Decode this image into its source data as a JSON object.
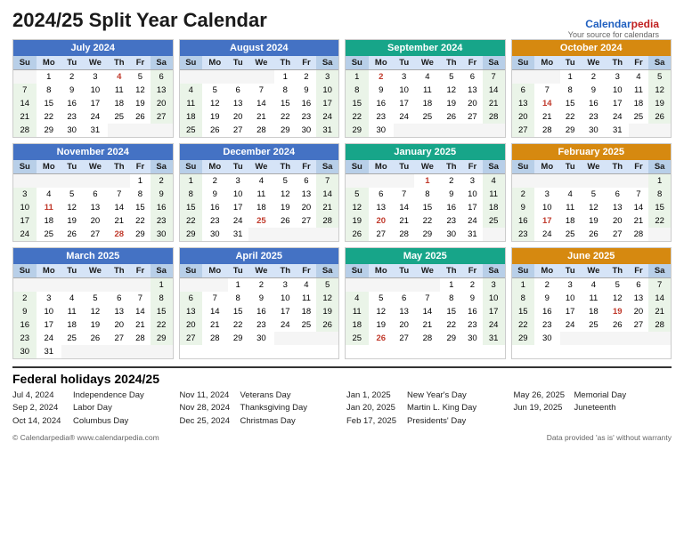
{
  "title": "2024/25 Split Year Calendar",
  "brand": {
    "name1": "Calendar",
    "name2": "pedia",
    "tagline": "Your source for calendars"
  },
  "months": [
    {
      "name": "July 2024",
      "color": "blue",
      "days": [
        [
          null,
          1,
          2,
          3,
          "4h",
          5,
          6
        ],
        [
          7,
          8,
          9,
          10,
          11,
          12,
          13
        ],
        [
          14,
          15,
          16,
          17,
          18,
          19,
          20
        ],
        [
          21,
          22,
          23,
          24,
          25,
          26,
          27
        ],
        [
          28,
          29,
          30,
          31,
          null,
          null,
          null
        ]
      ]
    },
    {
      "name": "August 2024",
      "color": "blue",
      "days": [
        [
          null,
          null,
          null,
          null,
          1,
          2,
          3
        ],
        [
          4,
          5,
          6,
          7,
          8,
          9,
          10
        ],
        [
          11,
          12,
          13,
          14,
          15,
          16,
          17
        ],
        [
          18,
          19,
          20,
          21,
          22,
          23,
          24
        ],
        [
          25,
          26,
          27,
          28,
          29,
          30,
          31
        ]
      ]
    },
    {
      "name": "September 2024",
      "color": "teal",
      "days": [
        [
          1,
          "2h",
          3,
          4,
          5,
          6,
          7
        ],
        [
          8,
          9,
          10,
          11,
          12,
          13,
          14
        ],
        [
          15,
          16,
          17,
          18,
          19,
          20,
          21
        ],
        [
          22,
          23,
          24,
          25,
          26,
          27,
          28
        ],
        [
          29,
          30,
          null,
          null,
          null,
          null,
          null
        ]
      ]
    },
    {
      "name": "October 2024",
      "color": "orange",
      "days": [
        [
          null,
          null,
          1,
          2,
          3,
          4,
          5
        ],
        [
          6,
          7,
          8,
          9,
          10,
          11,
          12
        ],
        [
          13,
          "14h",
          15,
          16,
          17,
          18,
          19
        ],
        [
          20,
          21,
          22,
          23,
          24,
          25,
          26
        ],
        [
          27,
          28,
          29,
          30,
          31,
          null,
          null
        ]
      ]
    },
    {
      "name": "November 2024",
      "color": "blue",
      "days": [
        [
          null,
          null,
          null,
          null,
          null,
          1,
          2
        ],
        [
          3,
          4,
          5,
          6,
          7,
          8,
          9
        ],
        [
          10,
          "11h",
          12,
          13,
          14,
          15,
          16
        ],
        [
          17,
          18,
          19,
          20,
          21,
          22,
          23
        ],
        [
          24,
          25,
          26,
          27,
          "28h",
          29,
          30
        ]
      ]
    },
    {
      "name": "December 2024",
      "color": "blue",
      "days": [
        [
          1,
          2,
          3,
          4,
          5,
          6,
          7
        ],
        [
          8,
          9,
          10,
          11,
          12,
          13,
          14
        ],
        [
          15,
          16,
          17,
          18,
          19,
          20,
          21
        ],
        [
          22,
          23,
          24,
          "25h",
          26,
          27,
          28
        ],
        [
          29,
          30,
          31,
          null,
          null,
          null,
          null
        ]
      ]
    },
    {
      "name": "January 2025",
      "color": "teal",
      "days": [
        [
          null,
          null,
          null,
          "1h",
          2,
          3,
          4
        ],
        [
          5,
          6,
          7,
          8,
          9,
          10,
          11
        ],
        [
          12,
          13,
          14,
          15,
          16,
          17,
          18
        ],
        [
          19,
          "20h",
          21,
          22,
          23,
          24,
          25
        ],
        [
          26,
          27,
          28,
          29,
          30,
          31,
          null
        ]
      ]
    },
    {
      "name": "February 2025",
      "color": "orange",
      "days": [
        [
          null,
          null,
          null,
          null,
          null,
          null,
          1
        ],
        [
          2,
          3,
          4,
          5,
          6,
          7,
          8
        ],
        [
          9,
          10,
          11,
          12,
          13,
          14,
          15
        ],
        [
          16,
          "17h",
          18,
          19,
          20,
          21,
          22
        ],
        [
          23,
          24,
          25,
          26,
          27,
          28,
          null
        ]
      ]
    },
    {
      "name": "March 2025",
      "color": "blue",
      "days": [
        [
          null,
          null,
          null,
          null,
          null,
          null,
          1
        ],
        [
          2,
          3,
          4,
          5,
          6,
          7,
          8
        ],
        [
          9,
          10,
          11,
          12,
          13,
          14,
          15
        ],
        [
          16,
          17,
          18,
          19,
          20,
          21,
          22
        ],
        [
          23,
          24,
          25,
          26,
          27,
          28,
          29
        ],
        [
          30,
          31,
          null,
          null,
          null,
          null,
          null
        ]
      ]
    },
    {
      "name": "April 2025",
      "color": "blue",
      "days": [
        [
          null,
          null,
          1,
          2,
          3,
          4,
          5
        ],
        [
          6,
          7,
          8,
          9,
          10,
          11,
          12
        ],
        [
          13,
          14,
          15,
          16,
          17,
          18,
          19
        ],
        [
          20,
          21,
          22,
          23,
          24,
          25,
          26
        ],
        [
          27,
          28,
          29,
          30,
          null,
          null,
          null
        ]
      ]
    },
    {
      "name": "May 2025",
      "color": "teal",
      "days": [
        [
          null,
          null,
          null,
          null,
          1,
          2,
          3
        ],
        [
          4,
          5,
          6,
          7,
          8,
          9,
          10
        ],
        [
          11,
          12,
          13,
          14,
          15,
          16,
          17
        ],
        [
          18,
          19,
          20,
          21,
          22,
          23,
          24
        ],
        [
          25,
          "26h",
          27,
          28,
          29,
          30,
          31
        ]
      ]
    },
    {
      "name": "June 2025",
      "color": "orange",
      "days": [
        [
          1,
          2,
          3,
          4,
          5,
          6,
          7
        ],
        [
          8,
          9,
          10,
          11,
          12,
          13,
          14
        ],
        [
          15,
          16,
          17,
          18,
          "19h",
          20,
          21
        ],
        [
          22,
          23,
          24,
          25,
          26,
          27,
          28
        ],
        [
          29,
          30,
          null,
          null,
          null,
          null,
          null
        ]
      ]
    }
  ],
  "holidays_title": "Federal holidays 2024/25",
  "holidays": [
    [
      {
        "date": "Jul 4, 2024",
        "name": "Independence Day"
      },
      {
        "date": "Sep 2, 2024",
        "name": "Labor Day"
      },
      {
        "date": "Oct 14, 2024",
        "name": "Columbus Day"
      }
    ],
    [
      {
        "date": "Nov 11, 2024",
        "name": "Veterans Day"
      },
      {
        "date": "Nov 28, 2024",
        "name": "Thanksgiving Day"
      },
      {
        "date": "Dec 25, 2024",
        "name": "Christmas Day"
      }
    ],
    [
      {
        "date": "Jan 1, 2025",
        "name": "New Year's Day"
      },
      {
        "date": "Jan 20, 2025",
        "name": "Martin L. King Day"
      },
      {
        "date": "Feb 17, 2025",
        "name": "Presidents' Day"
      }
    ],
    [
      {
        "date": "May 26, 2025",
        "name": "Memorial Day"
      },
      {
        "date": "Jun 19, 2025",
        "name": "Juneteenth"
      }
    ]
  ],
  "footer_left": "© Calendarpedia®   www.calendarpedia.com",
  "footer_right": "Data provided 'as is' without warranty",
  "weekdays": [
    "Su",
    "Mo",
    "Tu",
    "We",
    "Th",
    "Fr",
    "Sa"
  ]
}
